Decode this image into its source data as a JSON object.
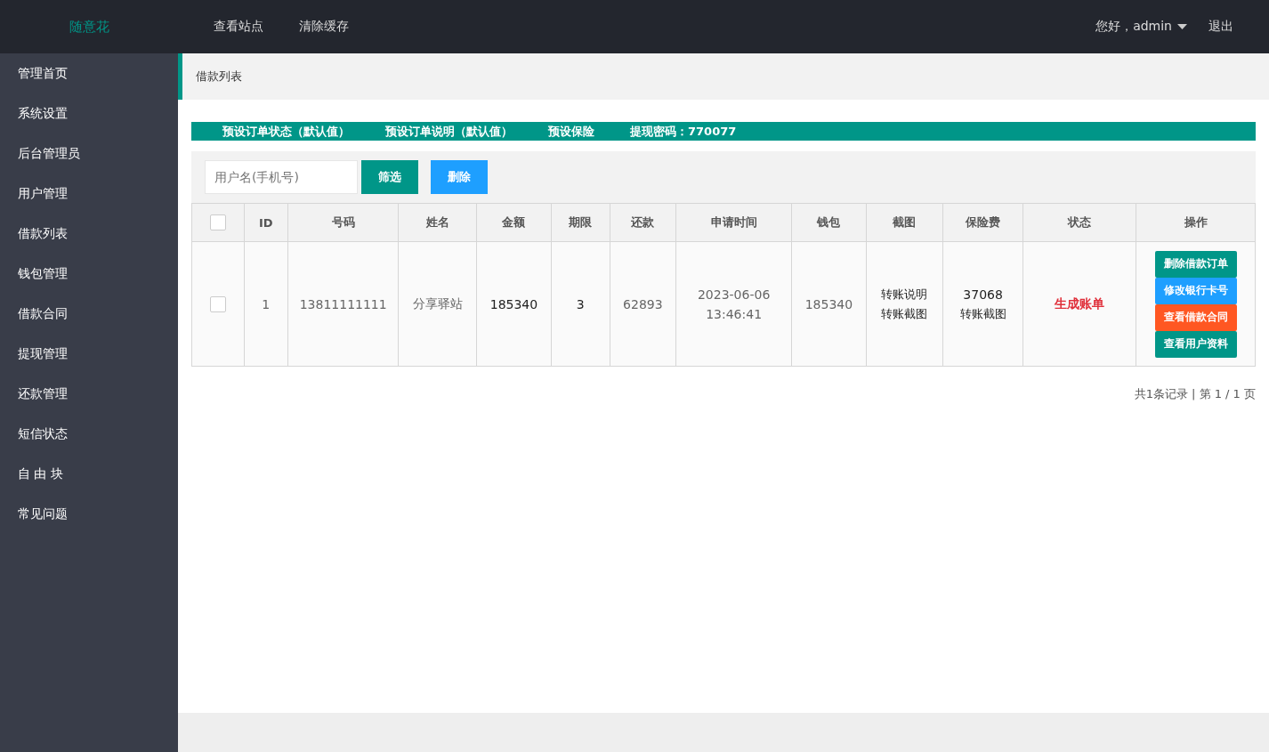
{
  "header": {
    "logo": "随意花",
    "nav": [
      "查看站点",
      "清除缓存"
    ],
    "user": "您好，admin",
    "logout": "退出"
  },
  "sidebar": {
    "items": [
      {
        "label": "管理首页",
        "selected": false
      },
      {
        "label": "系统设置",
        "selected": false
      },
      {
        "label": "后台管理员",
        "selected": false
      },
      {
        "label": "用户管理",
        "selected": false
      },
      {
        "label": "借款列表",
        "selected": false
      },
      {
        "label": "钱包管理",
        "selected": false
      },
      {
        "label": "借款合同",
        "selected": false
      },
      {
        "label": "提现管理",
        "selected": false
      },
      {
        "label": "还款管理",
        "selected": false
      },
      {
        "label": "短信状态",
        "selected": false
      },
      {
        "label": "自 由 块",
        "selected": false
      },
      {
        "label": "常见问题",
        "selected": false
      }
    ]
  },
  "breadcrumb": "借款列表",
  "preset_bar": [
    "预设订单状态（默认值）",
    "预设订单说明（默认值）",
    "预设保险",
    "提现密码：770077"
  ],
  "filter": {
    "placeholder": "用户名(手机号)",
    "buttons": [
      {
        "label": "筛选",
        "color": "#009688"
      },
      {
        "label": "删除",
        "color": "#1e9fff"
      }
    ]
  },
  "table": {
    "select_all": {
      "checked": false
    },
    "columns": [
      "ID",
      "号码",
      "姓名",
      "金额",
      "期限",
      "还款",
      "申请时间",
      "钱包",
      "截图",
      "保险费",
      "状态",
      "操作"
    ],
    "rows": [
      {
        "checked": false,
        "id": "1",
        "phone": "13811111111",
        "name": "分享驿站",
        "amount": "185340",
        "term": "3",
        "repayment": "62893",
        "time": [
          "2023-06-06",
          "13:46:41"
        ],
        "wallet": "185340",
        "screenshot": [
          "转账说明",
          "转账截图"
        ],
        "insurance": [
          "37068",
          "转账截图"
        ],
        "status": "生成账单",
        "actions": [
          {
            "label": "删除借款订单",
            "color": "#009688"
          },
          {
            "label": "修改银行卡号",
            "color": "#1e9fff"
          },
          {
            "label": "查看借款合同",
            "color": "#ff5722"
          },
          {
            "label": "查看用户资料",
            "color": "#009688"
          }
        ]
      }
    ]
  },
  "pagination": "共1条记录 | 第 1 / 1 页"
}
